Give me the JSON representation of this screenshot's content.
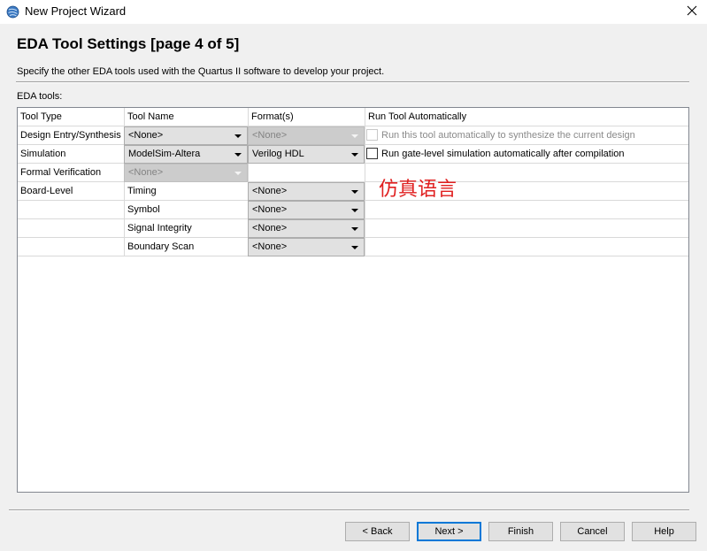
{
  "window": {
    "title": "New Project Wizard",
    "icon": "quartus-globe-icon",
    "close_icon": "close-icon"
  },
  "page": {
    "heading": "EDA Tool Settings [page 4 of 5]",
    "description": "Specify the other EDA tools used with the Quartus II software to develop your project.",
    "section_label": "EDA tools:"
  },
  "table": {
    "headers": [
      "Tool Type",
      "Tool Name",
      "Format(s)",
      "Run Tool Automatically"
    ],
    "rows": [
      {
        "tool_type": "Design Entry/Synthesis",
        "tool_name": "<None>",
        "tool_name_enabled": true,
        "format": "<None>",
        "format_enabled": false,
        "run_auto_label": "Run this tool automatically to synthesize the current design",
        "run_auto_checked": false,
        "run_auto_enabled": false
      },
      {
        "tool_type": "Simulation",
        "tool_name": "ModelSim-Altera",
        "tool_name_enabled": true,
        "format": "Verilog HDL",
        "format_enabled": true,
        "run_auto_label": "Run gate-level simulation automatically after compilation",
        "run_auto_checked": false,
        "run_auto_enabled": true
      },
      {
        "tool_type": "Formal Verification",
        "tool_name": "<None>",
        "tool_name_enabled": false
      },
      {
        "tool_type": "Board-Level",
        "tool_name": "Timing",
        "format": "<None>",
        "format_enabled": true
      },
      {
        "tool_type": "",
        "tool_name": "Symbol",
        "format": "<None>",
        "format_enabled": true
      },
      {
        "tool_type": "",
        "tool_name": "Signal Integrity",
        "format": "<None>",
        "format_enabled": true
      },
      {
        "tool_type": "",
        "tool_name": "Boundary Scan",
        "format": "<None>",
        "format_enabled": true
      }
    ]
  },
  "annotation": {
    "text": "仿真语言",
    "color": "#e02020"
  },
  "buttons": {
    "back": "< Back",
    "next": "Next >",
    "finish": "Finish",
    "cancel": "Cancel",
    "help": "Help"
  },
  "colors": {
    "default_button_border": "#0078d7",
    "background": "#f0f0f0"
  }
}
